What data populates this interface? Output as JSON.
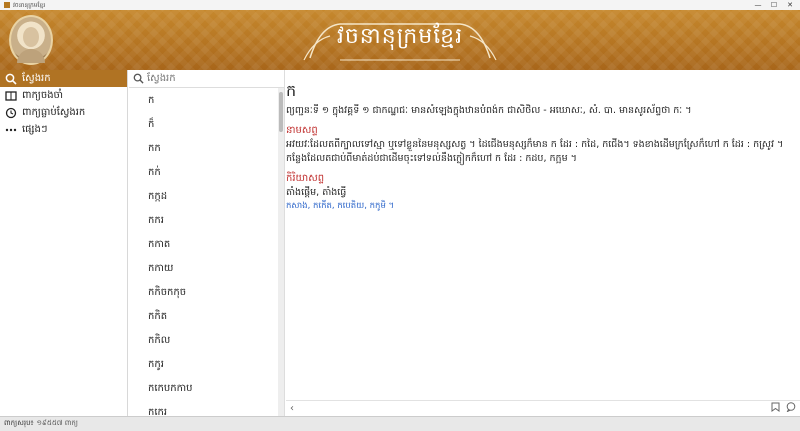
{
  "window": {
    "title": "វចនានុក្រមខ្មែរ",
    "controls": [
      "—",
      "☐",
      "✕"
    ]
  },
  "header": {
    "title": "វចនានុក្រមខ្មែរ"
  },
  "nav": {
    "items": [
      {
        "icon": "search-icon",
        "label": "ស្វែងរក",
        "active": true
      },
      {
        "icon": "book-icon",
        "label": "ពាក្យចងចាំ",
        "active": false
      },
      {
        "icon": "history-icon",
        "label": "ពាក្យធ្លាប់ស្វែងរក",
        "active": false
      },
      {
        "icon": "more-icon",
        "label": "ផ្សេងៗ",
        "active": false
      }
    ]
  },
  "search": {
    "placeholder": "ស្វែងរក"
  },
  "words": [
    "ក",
    "ក៏",
    "កក",
    "កក់",
    "កក្កដ",
    "កករ",
    "កកាត",
    "កកាយ",
    "កកិចកកុច",
    "កកិត",
    "កកិល",
    "កកូរ",
    "កកេបកកាប",
    "កកេរ",
    "កកេះ"
  ],
  "detail": {
    "headword": "ក",
    "definition": "ព្យញ្ជនៈទី ១ ក្នុងវគ្គទី ១ ជាកណ្ឋជៈ មានសំឡេងក្នុងឋានបំពង់ក ជាសិថិល - អឃោសៈ, សំ. បា. មានសូរស័ព្ទថា កៈ ។",
    "sections": [
      {
        "pos": "នាមសព្ទ",
        "text": "អវយវៈដែលតពីក្បាលទៅស្មា ឬទៅខ្លួននៃមនុស្សសត្វ ។ ដៃជើងមនុស្សក៏មាន ក ដែរ : កដៃ, កជើង។ ទងខាងដើមក្រស្រែក៏ហៅ ក ដែរ : កស្រូវ ។ កន្លែងដែលតជាប់ពីមាត់ដប់ជាដើមចុះទៅទល់នឹងក្លៀកក៏ហៅ ក ដែរ : កដប, កក្អម ។",
        "links": ""
      },
      {
        "pos": "កិរិយាសព្ទ",
        "text": "តាំងផ្ដើម, តាំងធ្វើ",
        "links": "កសាង, កកើត, កបេតិយ, កកូមិ ។"
      }
    ]
  },
  "bottombar": {
    "back": "‹",
    "icons": [
      "bookmark-icon",
      "comment-icon"
    ]
  },
  "status": {
    "label": "ពាក្យសរុប៖",
    "value": "១៩៥៥៧ ពាក្យ"
  },
  "colors": {
    "accent": "#b07323",
    "pos": "#c0302f",
    "link": "#2a64c9"
  }
}
